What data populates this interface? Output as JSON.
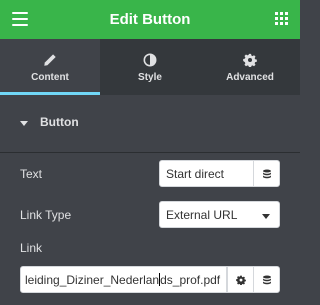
{
  "header": {
    "title": "Edit Button",
    "menu_icon": "hamburger-menu-icon",
    "grid_icon": "widgets-grid-icon",
    "background": "#39b54a"
  },
  "tabs": [
    {
      "label": "Content",
      "icon": "pencil-icon",
      "active": true
    },
    {
      "label": "Style",
      "icon": "half-circle-icon",
      "active": false
    },
    {
      "label": "Advanced",
      "icon": "gear-icon",
      "active": false
    }
  ],
  "section": {
    "label": "Button",
    "caret_icon": "caret-down-icon"
  },
  "fields": {
    "text": {
      "label": "Text",
      "value": "Start direct",
      "icon": "database-icon"
    },
    "link_type": {
      "label": "Link Type",
      "value": "External URL"
    },
    "link": {
      "label": "Link",
      "value_before_cursor": "leiding_Diziner_Nederlan",
      "value_after_cursor": "ds_prof.pdf",
      "gear_icon": "gear-icon",
      "db_icon": "database-icon"
    }
  },
  "colors": {
    "panel_bg": "#404349",
    "tab_active_indicator": "#71d7f7"
  }
}
